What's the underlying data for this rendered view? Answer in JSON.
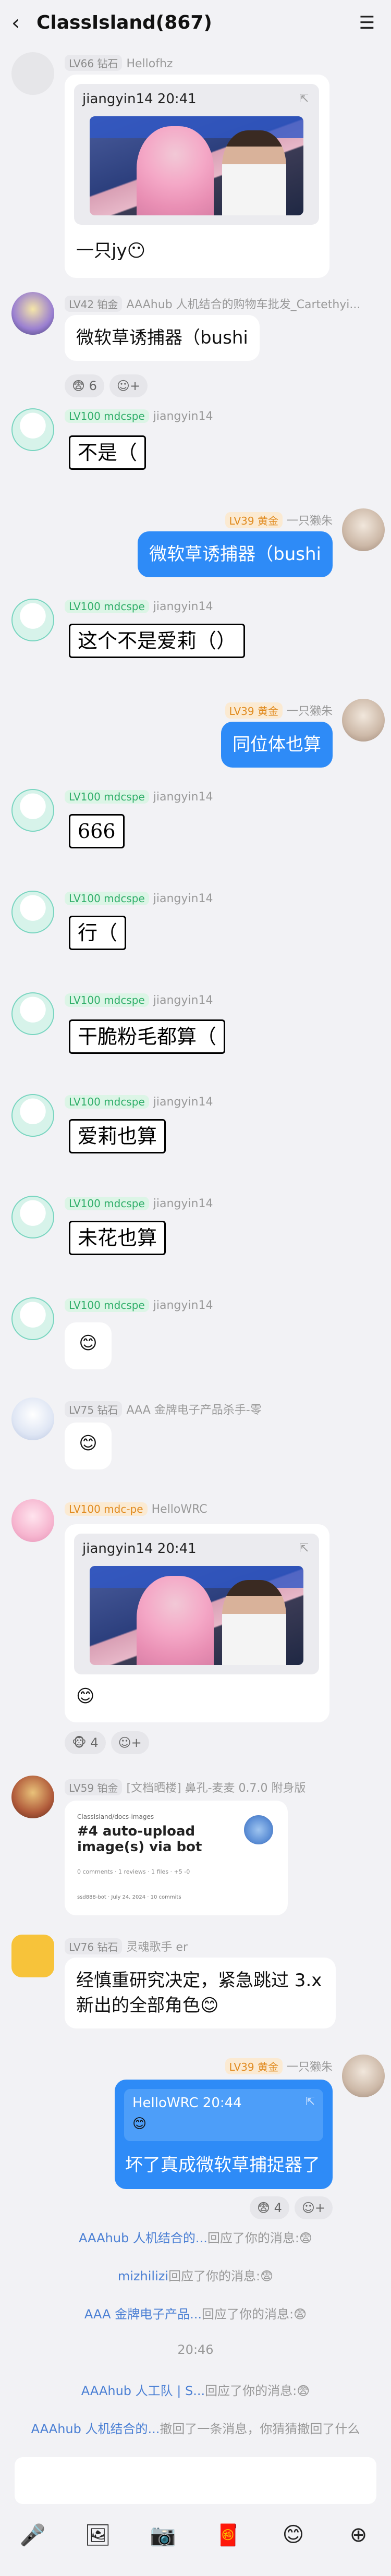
{
  "header": {
    "back": "‹",
    "title": "ClassIsland(867)",
    "menu": "☰"
  },
  "messages": [
    {
      "level": "LV66 钻石",
      "name": "Hellofhz",
      "reply_name": "jiangyin14 20:41",
      "text": "一只jy😶"
    },
    {
      "level": "LV42 铂金",
      "name": "AAAhub 人机结合的购物车批发_Cartethyi...",
      "text": "微软草诱捕器（bushi",
      "reaction": "😨 6"
    },
    {
      "level": "LV100 mdcspe",
      "name": "jiangyin14",
      "sticker": "不是（"
    },
    {
      "level": "LV39 黄金",
      "name": "一只獭朱",
      "text": "微软草诱捕器（bushi"
    },
    {
      "level": "LV100 mdcspe",
      "name": "jiangyin14",
      "sticker": "这个不是爱莉（）"
    },
    {
      "level": "LV39 黄金",
      "name": "一只獭朱",
      "text": "同位体也算"
    },
    {
      "level": "LV100 mdcspe",
      "name": "jiangyin14",
      "sticker": "666"
    },
    {
      "level": "LV100 mdcspe",
      "name": "jiangyin14",
      "sticker": "行（"
    },
    {
      "level": "LV100 mdcspe",
      "name": "jiangyin14",
      "sticker": "干脆粉毛都算（"
    },
    {
      "level": "LV100 mdcspe",
      "name": "jiangyin14",
      "sticker": "爱莉也算"
    },
    {
      "level": "LV100 mdcspe",
      "name": "jiangyin14",
      "sticker": "未花也算"
    },
    {
      "level": "LV100 mdcspe",
      "name": "jiangyin14",
      "emoji": "😊"
    },
    {
      "level": "LV75 钻石",
      "name": "AAA 金牌电子产品杀手-零",
      "emoji": "😊"
    },
    {
      "level": "LV100 mdc-pe",
      "name": "HelloWRC",
      "reply_name": "jiangyin14 20:41",
      "emoji": "😊",
      "reaction": "🐵 4"
    },
    {
      "level": "LV59 铂金",
      "name": "[文档晒楼] 鼻孔-麦麦 0.7.0 附身版",
      "link_repo": "ClassIsland/docs-images",
      "link_title": "#4 auto-upload image(s) via bot",
      "link_meta": "0 comments · 1 reviews · 1 files · +5 -0",
      "link_footer": "ssd888-bot · July 24, 2024 · 10 commits"
    },
    {
      "level": "LV76 钻石",
      "name": "灵魂歌手 er",
      "text": "经慎重研究决定，紧急跳过 3.x新出的全部角色😊"
    },
    {
      "level": "LV39 黄金",
      "name": "一只獭朱",
      "reply_name": "HelloWRC 20:44",
      "reply_emoji": "😊",
      "text": "坏了真成微软草捕捉器了",
      "reaction": "😨 4"
    }
  ],
  "system": [
    {
      "link": "AAAhub 人机结合的...",
      "text": "回应了你的消息:😨"
    },
    {
      "link": "mizhilizi",
      "text": "回应了你的消息:😨"
    },
    {
      "link": "AAA 金牌电子产品...",
      "text": "回应了你的消息:😨"
    },
    {
      "time": "20:46"
    },
    {
      "link": "AAAhub 人工队 | S...",
      "text": "回应了你的消息:😨"
    },
    {
      "link": "AAAhub 人机结合的...",
      "text": "撤回了一条消息，你猜猜撤回了什么"
    }
  ],
  "toolbar": {
    "icons": [
      "🎤",
      "🖼",
      "📷",
      "🧧",
      "😊",
      "⊕"
    ]
  },
  "colors": {
    "blue_bubble": "#2e8bf7",
    "bg": "#f2f2f5"
  }
}
